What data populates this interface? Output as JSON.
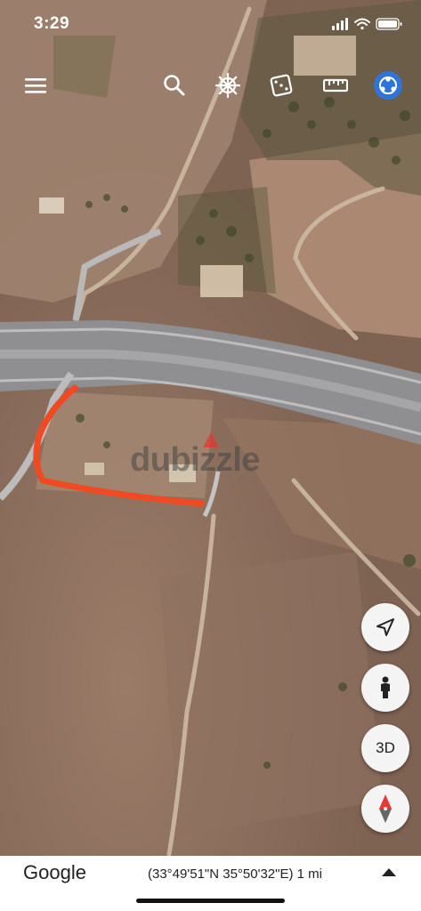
{
  "status_bar": {
    "time": "3:29",
    "icons": [
      "signal-icon",
      "wifi-icon",
      "battery-icon"
    ]
  },
  "toolbar": {
    "icons": [
      "menu-icon",
      "search-icon",
      "steering-wheel-icon",
      "dice-icon",
      "ruler-icon",
      "globe-icon"
    ],
    "accent_color": "#2f74d8"
  },
  "map": {
    "type": "satellite",
    "annotation": {
      "kind": "hand-drawn-route",
      "color": "#f04a23"
    },
    "watermark": "dubizzle",
    "watermark_color": "#e23a2b"
  },
  "controls": {
    "my_location_icon": "navigation-arrow-icon",
    "street_view_icon": "pegman-icon",
    "view_3d_label": "3D",
    "compass_icon": "compass-icon"
  },
  "bottom_bar": {
    "logo": "Google",
    "coordinates": "(33°49'51\"N 35°50'32\"E) 1 mi",
    "expand_icon": "chevron-up-icon"
  }
}
